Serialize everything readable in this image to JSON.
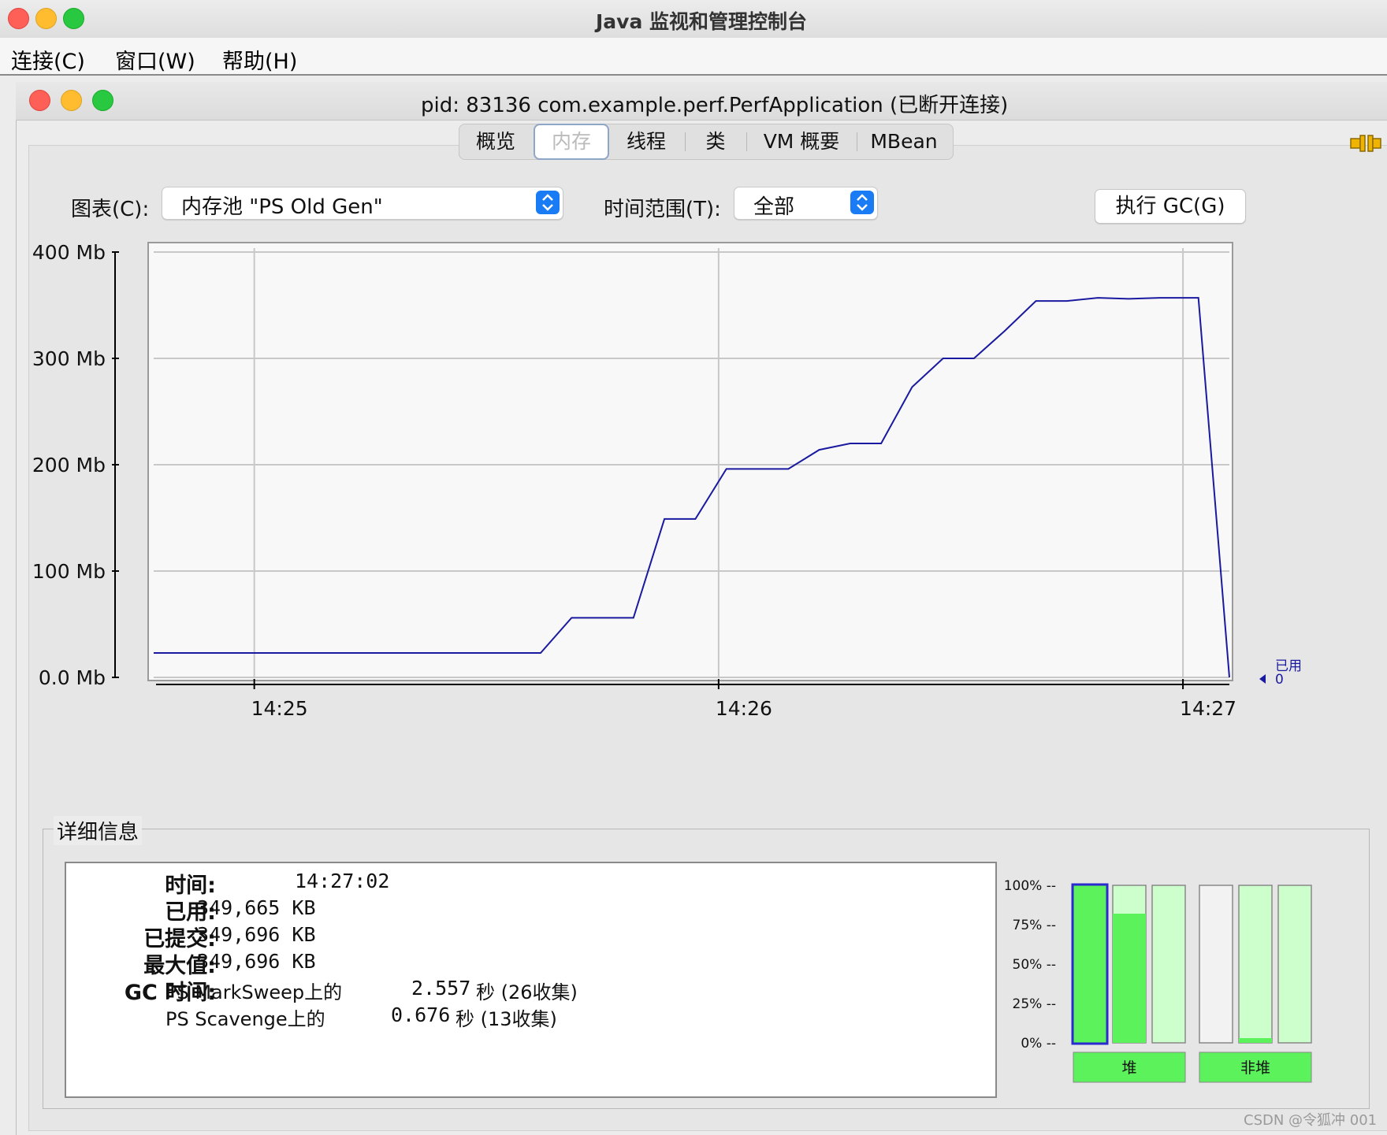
{
  "app": {
    "window_title": "Java 监视和管理控制台",
    "menu": [
      "连接(C)",
      "窗口(W)",
      "帮助(H)"
    ]
  },
  "inner_window": {
    "title": "pid: 83136 com.example.perf.PerfApplication (已断开连接)"
  },
  "tabs": [
    {
      "label": "概览",
      "active": false
    },
    {
      "label": "内存",
      "active": true
    },
    {
      "label": "线程",
      "active": false
    },
    {
      "label": "类",
      "active": false
    },
    {
      "label": "VM 概要",
      "active": false
    },
    {
      "label": "MBean",
      "active": false
    }
  ],
  "controls": {
    "chart_label": "图表(C):",
    "chart_select_value": "内存池 \"PS Old Gen\"",
    "time_range_label": "时间范围(T):",
    "time_range_value": "全部",
    "gc_button_label": "执行 GC(G)"
  },
  "chart_data": {
    "type": "line",
    "series": [
      {
        "name": "已用",
        "color": "#1a1aa0"
      }
    ],
    "x_ticks": [
      "14:25",
      "14:26",
      "14:27"
    ],
    "y_ticks": [
      "0.0 Mb",
      "100 Mb",
      "200 Mb",
      "300 Mb",
      "400 Mb"
    ],
    "ylim": [
      0,
      400
    ],
    "points": [
      [
        "14:24:47",
        23
      ],
      [
        "14:25:00",
        23
      ],
      [
        "14:25:30",
        23
      ],
      [
        "14:25:37",
        23
      ],
      [
        "14:25:41",
        56
      ],
      [
        "14:25:49",
        56
      ],
      [
        "14:25:53",
        149
      ],
      [
        "14:25:57",
        149
      ],
      [
        "14:26:01",
        196
      ],
      [
        "14:26:09",
        196
      ],
      [
        "14:26:13",
        214
      ],
      [
        "14:26:17",
        220
      ],
      [
        "14:26:21",
        220
      ],
      [
        "14:26:25",
        273
      ],
      [
        "14:26:29",
        300
      ],
      [
        "14:26:33",
        300
      ],
      [
        "14:26:37",
        326
      ],
      [
        "14:26:41",
        354
      ],
      [
        "14:26:45",
        354
      ],
      [
        "14:26:49",
        357
      ],
      [
        "14:26:53",
        356
      ],
      [
        "14:26:57",
        357
      ],
      [
        "14:27:02",
        357
      ],
      [
        "14:27:06",
        0
      ]
    ],
    "current_label": "已用",
    "current_value": "0",
    "grid": true
  },
  "details": {
    "section_title": "详细信息",
    "rows": [
      {
        "key": "时间:",
        "value": "14:27:02"
      },
      {
        "key": "已用:",
        "value": "349,665 KB"
      },
      {
        "key": "已提交:",
        "value": "349,696 KB"
      },
      {
        "key": "最大值:",
        "value": "349,696 KB"
      }
    ],
    "gc_key": "GC 时间:",
    "gc_rows": [
      {
        "collector": "PS MarkSweep上的",
        "time": "2.557",
        "unit": "秒 (26收集)"
      },
      {
        "collector": "PS Scavenge上的",
        "time": "0.676",
        "unit": "秒 (13收集)"
      }
    ]
  },
  "memory_bars": {
    "y_ticks": [
      "100% --",
      "75% --",
      "50% --",
      "25% --",
      "0% --"
    ],
    "heap_label": "堆",
    "nonheap_label": "非堆",
    "heap": [
      1.0,
      0.82,
      0.0
    ],
    "nonheap": [
      0.0,
      0.03,
      0.0
    ],
    "colors": {
      "used": "#5cf25c",
      "committed": "#ccffcc",
      "empty": "#f2f2f2"
    }
  },
  "watermark": "CSDN @令狐冲 001"
}
